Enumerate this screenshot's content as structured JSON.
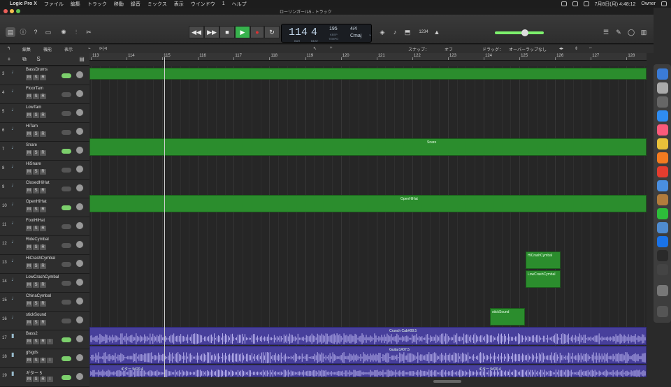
{
  "menubar": {
    "app": "Logic Pro X",
    "items": [
      "ファイル",
      "編集",
      "トラック",
      "移動",
      "録音",
      "ミックス",
      "表示",
      "ウインドウ",
      "1",
      "ヘルプ"
    ],
    "datetime": "7月8日(月)  4:48:12",
    "user": "Owner"
  },
  "window": {
    "title": "ローリンガール5 - トラック"
  },
  "lcd": {
    "bar": "114",
    "beat": "4",
    "bar_label": "BAR",
    "beat_label": "BEAT",
    "tempo": "195",
    "tempo_label": "KEEP",
    "tempo_label2": "TEMPO",
    "time_sig": "4/4",
    "key": "Cmaj"
  },
  "controlbar": {
    "counter": "1234"
  },
  "secbar": {
    "edit": "編集",
    "function": "機能",
    "view": "表示",
    "snap_label": "スナップ：",
    "snap_value": "オフ",
    "drag_label": "ドラッグ：",
    "drag_value": "オーバーラップなし"
  },
  "ruler": {
    "bars": [
      "113",
      "114",
      "115",
      "116",
      "117",
      "118",
      "119",
      "120",
      "121",
      "122",
      "123",
      "124",
      "125",
      "126",
      "127",
      "128"
    ]
  },
  "tracks": [
    {
      "num": "3",
      "name": "BassDrums",
      "icon": "drum-icon",
      "kind": "midi",
      "toggle_on": true
    },
    {
      "num": "4",
      "name": "FloorTam",
      "icon": "drum-icon",
      "kind": "midi",
      "toggle_on": false
    },
    {
      "num": "5",
      "name": "LowTam",
      "icon": "drum-icon",
      "kind": "midi",
      "toggle_on": false
    },
    {
      "num": "6",
      "name": "HiTam",
      "icon": "drum-icon",
      "kind": "midi",
      "toggle_on": false
    },
    {
      "num": "7",
      "name": "Snare",
      "icon": "drum-icon",
      "kind": "midi",
      "toggle_on": true
    },
    {
      "num": "8",
      "name": "HiSnare",
      "icon": "drum-icon",
      "kind": "midi",
      "toggle_on": false
    },
    {
      "num": "9",
      "name": "ClosedHiHat",
      "icon": "drum-icon",
      "kind": "midi",
      "toggle_on": false
    },
    {
      "num": "10",
      "name": "OpenHiHat",
      "icon": "drum-icon",
      "kind": "midi",
      "toggle_on": true
    },
    {
      "num": "11",
      "name": "FootHiHat",
      "icon": "drum-icon",
      "kind": "midi",
      "toggle_on": false
    },
    {
      "num": "12",
      "name": "RideCymbal",
      "icon": "drum-icon",
      "kind": "midi",
      "toggle_on": false
    },
    {
      "num": "13",
      "name": "HiCrashCymbal",
      "icon": "drum-icon",
      "kind": "midi",
      "toggle_on": false
    },
    {
      "num": "14",
      "name": "LowCrashCymbal",
      "icon": "drum-icon",
      "kind": "midi",
      "toggle_on": false
    },
    {
      "num": "15",
      "name": "ChinaCymbal",
      "icon": "drum-icon",
      "kind": "midi",
      "toggle_on": false
    },
    {
      "num": "16",
      "name": "stickSound",
      "icon": "drum-icon",
      "kind": "midi",
      "toggle_on": false
    },
    {
      "num": "17",
      "name": "Bass2",
      "icon": "bass-icon",
      "kind": "audio",
      "toggle_on": true
    },
    {
      "num": "18",
      "name": "gfsgds",
      "icon": "amp-icon",
      "kind": "audio",
      "toggle_on": true
    },
    {
      "num": "19",
      "name": "ギター 5",
      "icon": "amp-icon",
      "kind": "audio",
      "toggle_on": true
    }
  ],
  "msr": {
    "m": "M",
    "s": "S",
    "r": "R",
    "i": "I"
  },
  "regions": {
    "snare": "Snare",
    "openhihat": "OpenHiHat",
    "hicrash": "HiCrashCymbal",
    "lowcrash": "LowCrashCymbal",
    "stick": "stickSound",
    "bass": "Crunch Cab#08.5",
    "guitar1": "Guitar1#07.5",
    "guitar5a": "ギター 5#20.4",
    "guitar5b": "ギター 5#20.4"
  },
  "colors": {
    "midi_region": "#2b8d2d",
    "audio_region": "#473f9b",
    "play_green": "#37b24d"
  }
}
